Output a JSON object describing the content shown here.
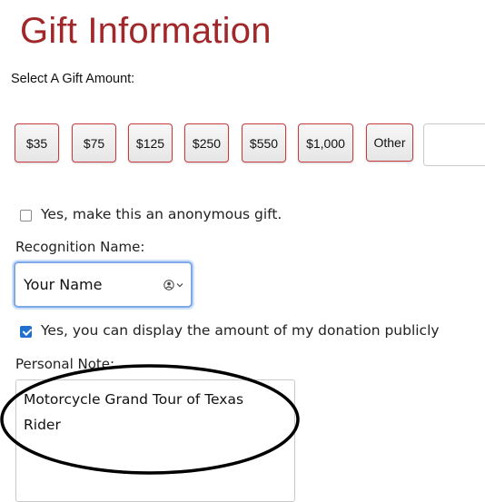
{
  "page": {
    "title": "Gift Information",
    "amount_prompt": "Select A Gift Amount:"
  },
  "amounts": [
    "$35",
    "$75",
    "$125",
    "$250",
    "$550",
    "$1,000",
    "Other"
  ],
  "anonymous": {
    "label": "Yes, make this an anonymous gift.",
    "checked": false
  },
  "recognition": {
    "label": "Recognition Name:",
    "value": "Your Name",
    "icon": "person-circle-icon"
  },
  "display_amount": {
    "label": "Yes, you can display the amount of my donation publicly",
    "checked": true
  },
  "note": {
    "label": "Personal Note:",
    "value": "Motorcycle Grand Tour of Texas\nRider"
  },
  "colors": {
    "title": "#a0282b",
    "button_border": "#c93a3f",
    "focus_ring": "#7ea9e6",
    "checkbox_checked": "#1f6fd0",
    "annotation_ellipse": "#000000"
  }
}
